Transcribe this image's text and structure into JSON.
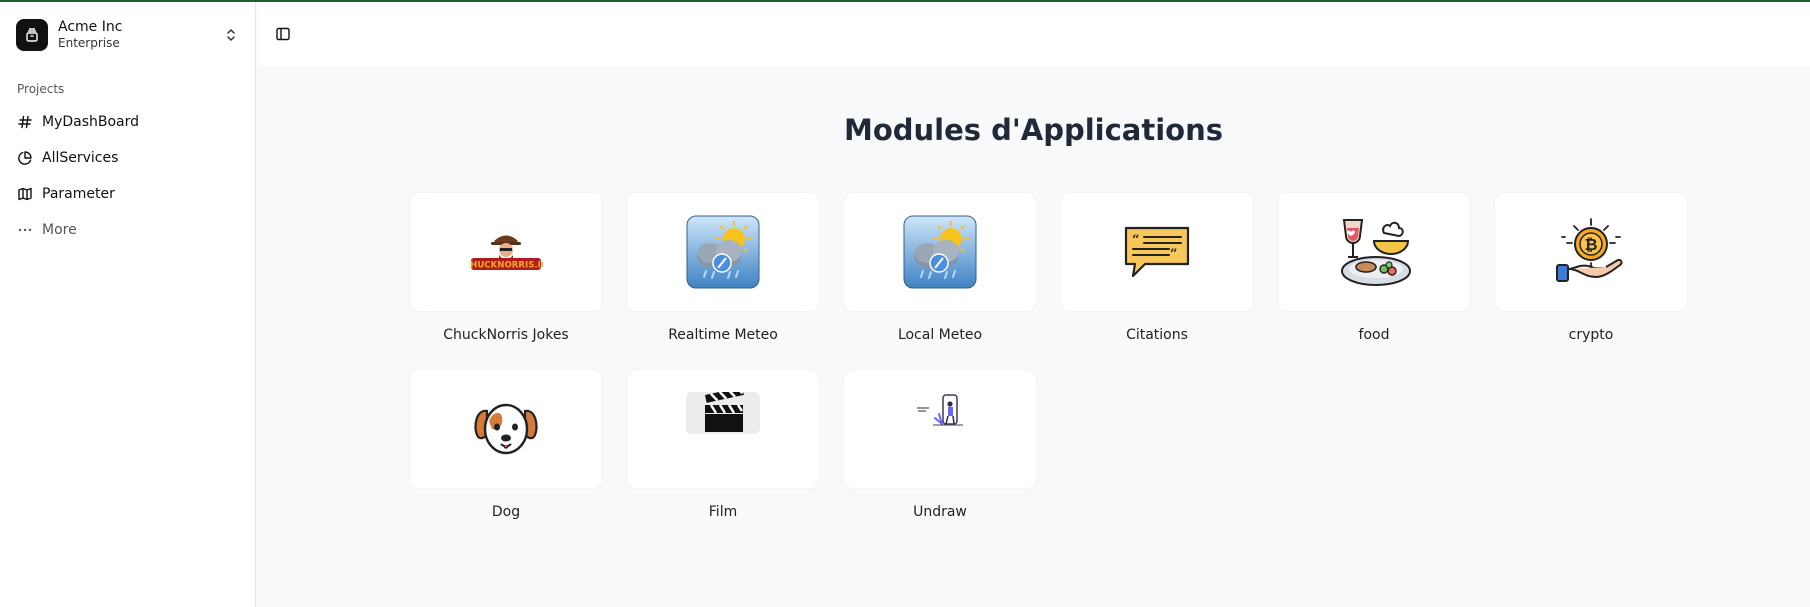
{
  "team": {
    "name": "Acme Inc",
    "plan": "Enterprise",
    "logo_icon": "box-icon"
  },
  "sidebar": {
    "group_label": "Projects",
    "items": [
      {
        "label": "MyDashBoard",
        "icon": "hash-icon"
      },
      {
        "label": "AllServices",
        "icon": "pie-chart-icon"
      },
      {
        "label": "Parameter",
        "icon": "map-icon"
      }
    ],
    "more_label": "More"
  },
  "header": {
    "toggle_icon": "sidebar-toggle-icon"
  },
  "main": {
    "title": "Modules d'Applications",
    "modules": [
      {
        "label": "ChuckNorris Jokes",
        "logo_text": "CHUCKNORRIS.IO"
      },
      {
        "label": "Realtime Meteo"
      },
      {
        "label": "Local Meteo"
      },
      {
        "label": "Citations"
      },
      {
        "label": "food"
      },
      {
        "label": "crypto"
      },
      {
        "label": "Dog"
      },
      {
        "label": "Film"
      },
      {
        "label": "Undraw"
      }
    ]
  },
  "colors": {
    "accent_border": "#1f5f2d",
    "background": "#f8f9fa",
    "sidebar_bg": "#ffffff"
  }
}
